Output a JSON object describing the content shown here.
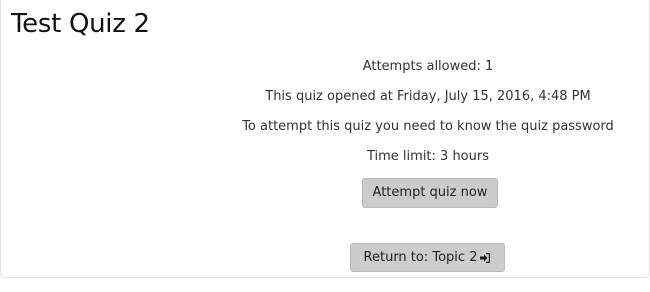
{
  "quiz": {
    "title": "Test Quiz 2",
    "attempts_allowed": "Attempts allowed: 1",
    "opened_at": "This quiz opened at Friday, July 15, 2016, 4:48 PM",
    "password_notice": "To attempt this quiz you need to know the quiz password",
    "time_limit": "Time limit: 3 hours"
  },
  "actions": {
    "attempt_label": "Attempt quiz now",
    "return_label": "Return to: Topic 2",
    "return_icon": "sign-in-icon"
  },
  "colors": {
    "button_background": "#cccccc",
    "text": "#333333"
  }
}
